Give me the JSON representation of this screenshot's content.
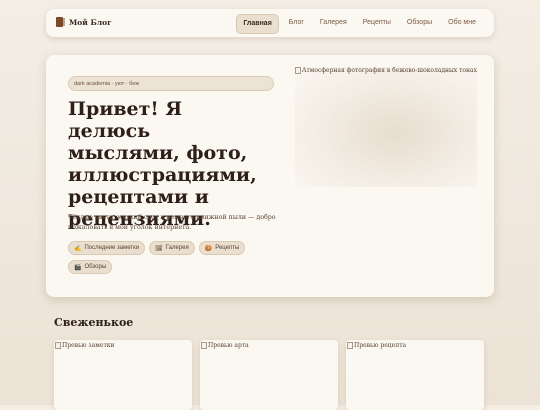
{
  "nav": {
    "logo_text": "Мой Блог",
    "items": [
      {
        "label": "Главная",
        "active": true
      },
      {
        "label": "Блог",
        "active": false
      },
      {
        "label": "Галерея",
        "active": false
      },
      {
        "label": "Рецепты",
        "active": false
      },
      {
        "label": "Обзоры",
        "active": false
      },
      {
        "label": "Обо мне",
        "active": false
      }
    ]
  },
  "hero": {
    "tagline": "dark academia · уют · беж",
    "title": "Привет! Я делюсь мыслями, фото, иллюстрациями, рецептами и рецензиями.",
    "description": "Тёплые цвета, мягкий свет и немного книжной пыли — добро пожаловать в мой уголок интернета.",
    "chips": [
      {
        "icon": "✍",
        "label": "Последние заметки"
      },
      {
        "icon": "🖼",
        "label": "Галерея"
      },
      {
        "icon": "🍪",
        "label": "Рецепты"
      },
      {
        "icon": "🎬",
        "label": "Обзоры"
      }
    ],
    "image_alt": "Атмосферная фотография в бежево-шоколадных тонах"
  },
  "fresh": {
    "title": "Свеженькое",
    "cards": [
      {
        "image_alt": "Превью заметки"
      },
      {
        "image_alt": "Превью арта"
      },
      {
        "image_alt": "Превью рецепта"
      }
    ]
  },
  "colors": {
    "background": "#efe7dc",
    "surface": "#fbf8f2",
    "accent": "#eadfce",
    "text": "#2e2018"
  }
}
